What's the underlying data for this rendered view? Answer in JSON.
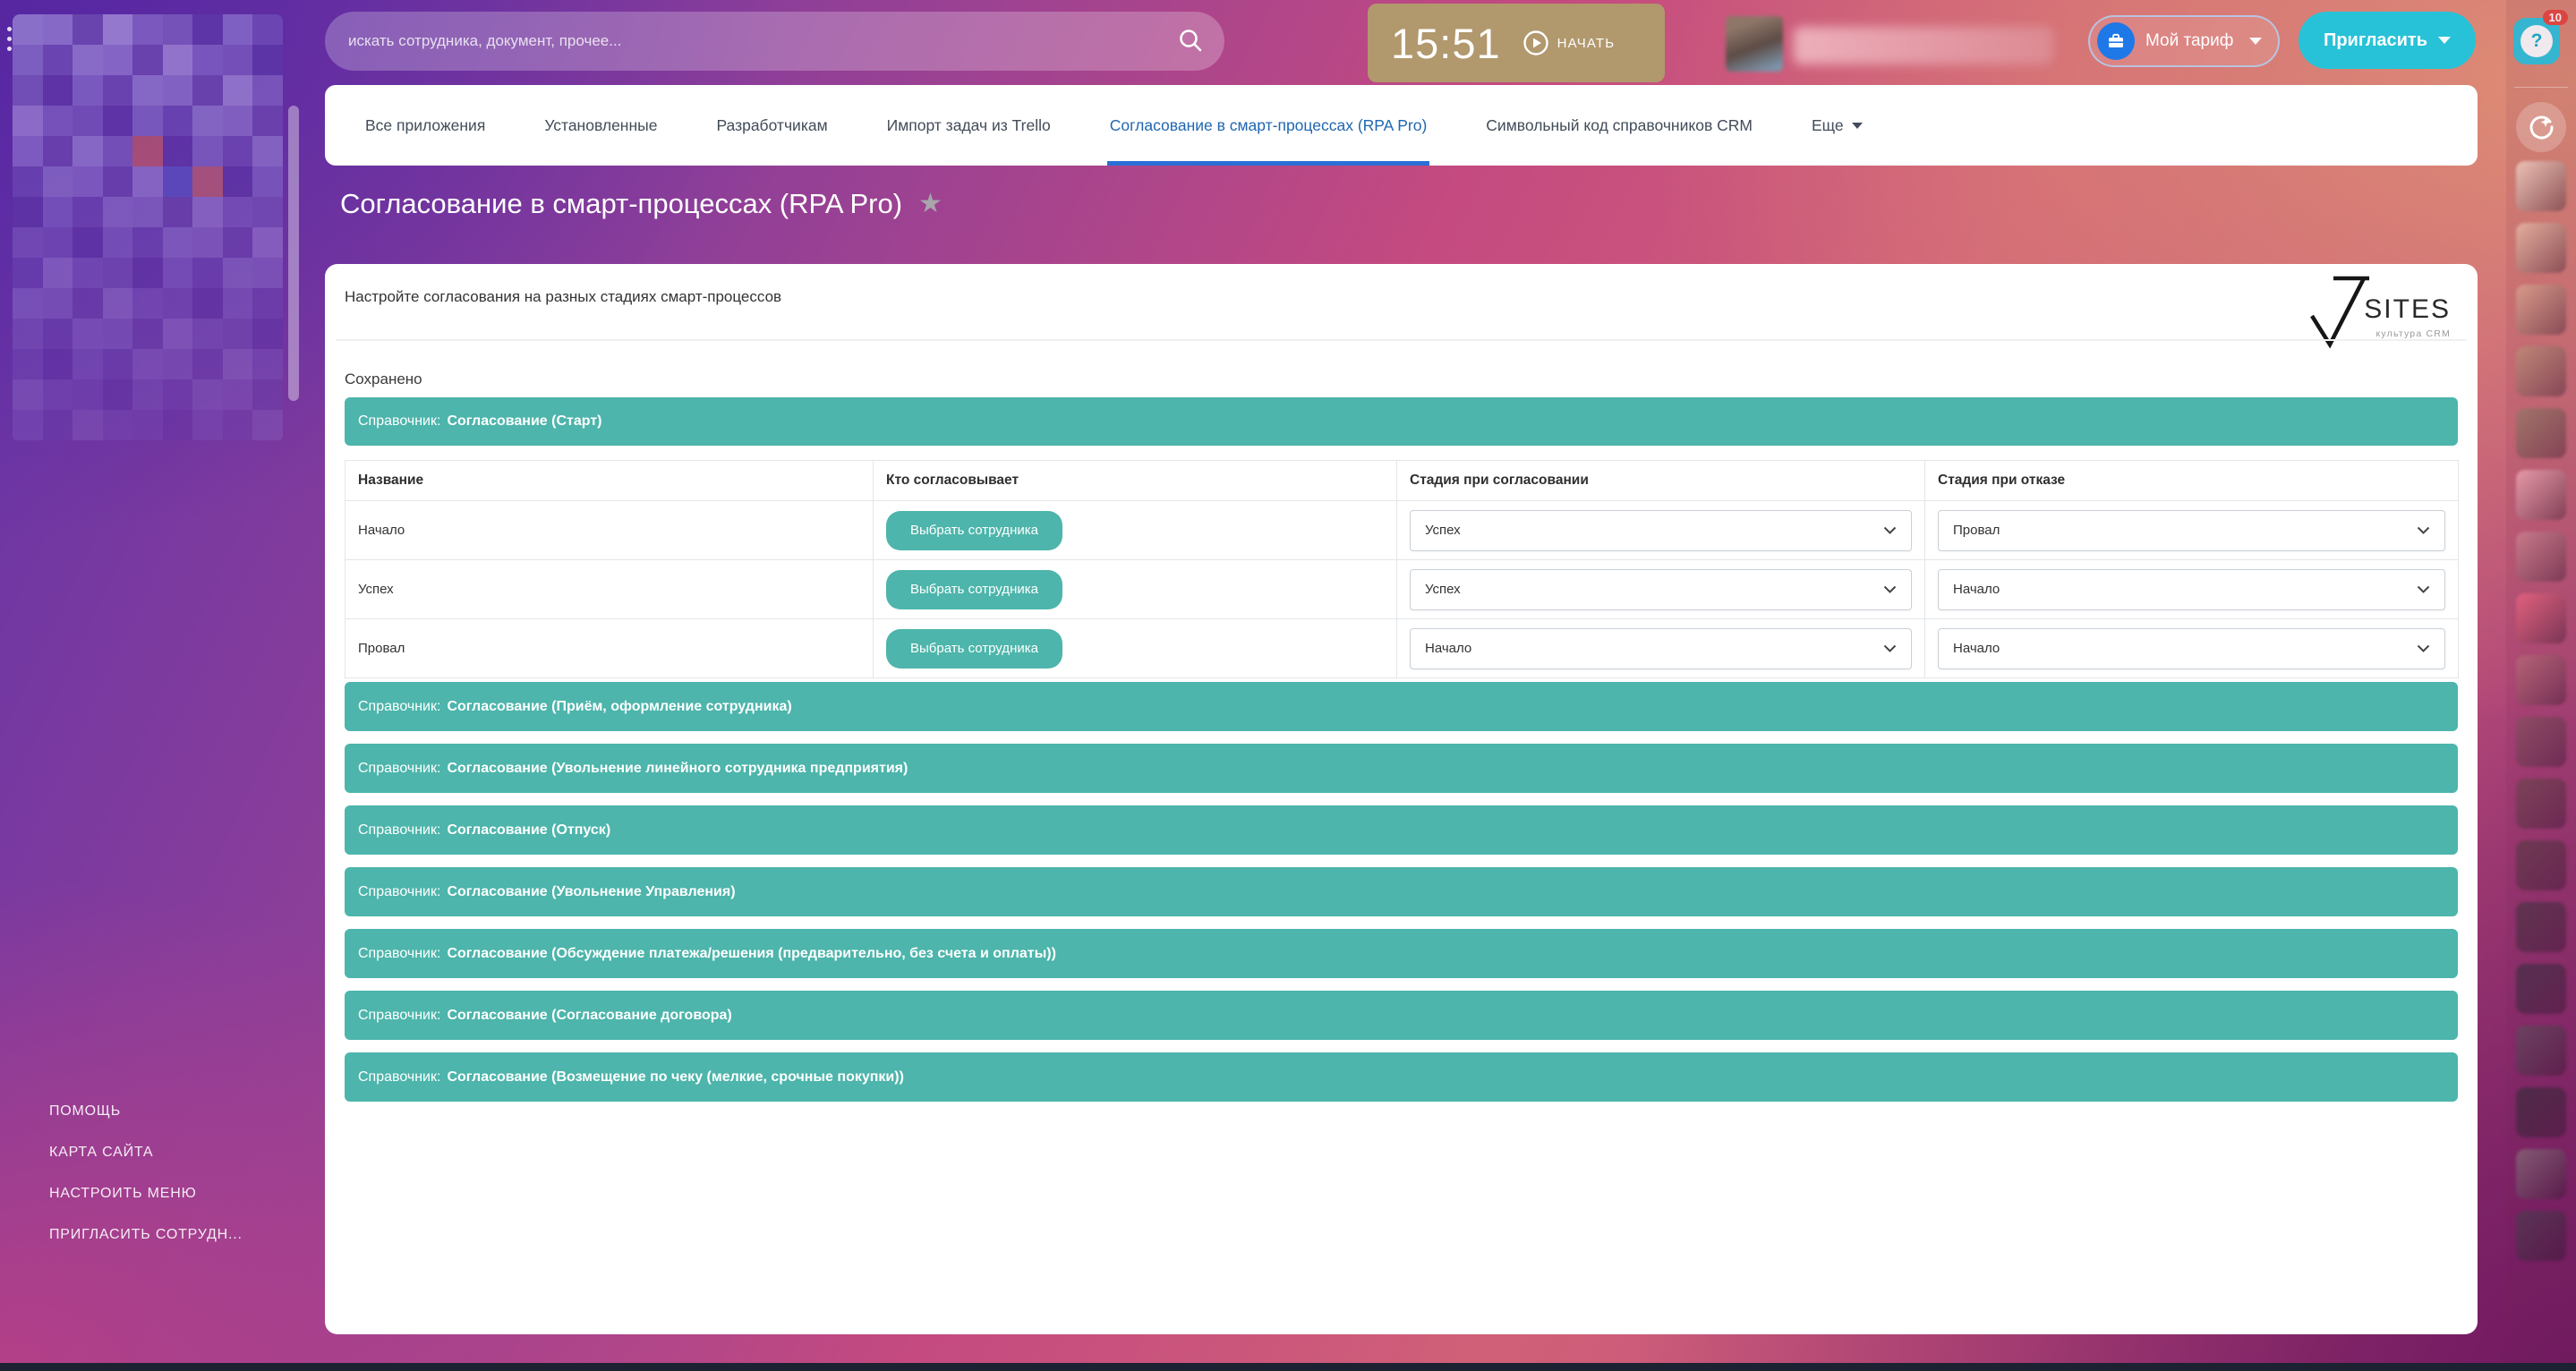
{
  "topbar": {
    "search_placeholder": "искать сотрудника, документ, прочее...",
    "timer_time": "15:51",
    "timer_action": "НАЧАТЬ",
    "plan_button": "Мой тариф",
    "invite_button": "Пригласить",
    "help_glyph": "?",
    "help_badge": "10"
  },
  "tabs": {
    "items": [
      {
        "label": "Все приложения"
      },
      {
        "label": "Установленные"
      },
      {
        "label": "Разработчикам"
      },
      {
        "label": "Импорт задач из Trello"
      },
      {
        "label": "Согласование в смарт-процессах (RPA Pro)"
      },
      {
        "label": "Символьный код справочников CRM"
      },
      {
        "label": "Еще"
      }
    ]
  },
  "page": {
    "title": "Согласование в смарт-процессах (RPA Pro)"
  },
  "card": {
    "intro": "Настройте согласования на разных стадиях смарт-процессов",
    "logo": {
      "text": "SITES",
      "sub": "культура CRM"
    },
    "saved_label": "Сохранено",
    "sections": {
      "prefix": "Справочник:",
      "items": [
        {
          "name": "Согласование (Старт)"
        },
        {
          "name": "Согласование (Приём, оформление сотрудника)"
        },
        {
          "name": "Согласование (Увольнение линейного сотрудника предприятия)"
        },
        {
          "name": "Согласование (Отпуск)"
        },
        {
          "name": "Согласование (Увольнение Управления)"
        },
        {
          "name": "Согласование (Обсуждение платежа/решения (предварительно, без счета и оплаты))"
        },
        {
          "name": "Согласование (Согласование договора)"
        },
        {
          "name": "Согласование (Возмещение по чеку (мелкие, срочные покупки))"
        }
      ]
    },
    "table": {
      "headers": [
        "Название",
        "Кто согласовывает",
        "Стадия при согласовании",
        "Стадия при отказе"
      ],
      "select_button": "Выбрать сотрудника",
      "rows": [
        {
          "name": "Начало",
          "approve_stage": "Успех",
          "reject_stage": "Провал"
        },
        {
          "name": "Успех",
          "approve_stage": "Успех",
          "reject_stage": "Начало"
        },
        {
          "name": "Провал",
          "approve_stage": "Начало",
          "reject_stage": "Начало"
        }
      ]
    }
  },
  "footer_links": [
    {
      "label": "ПОМОЩЬ"
    },
    {
      "label": "КАРТА САЙТА"
    },
    {
      "label": "НАСТРОИТЬ МЕНЮ"
    },
    {
      "label": "ПРИГЛАСИТЬ СОТРУДН..."
    }
  ],
  "colors": {
    "teal": "#4db5ab",
    "tab_active_blue": "#2067b0",
    "invite_cyan": "#27c2d8",
    "timer_tan": "#b1986d",
    "badge_red": "#e9493f"
  }
}
